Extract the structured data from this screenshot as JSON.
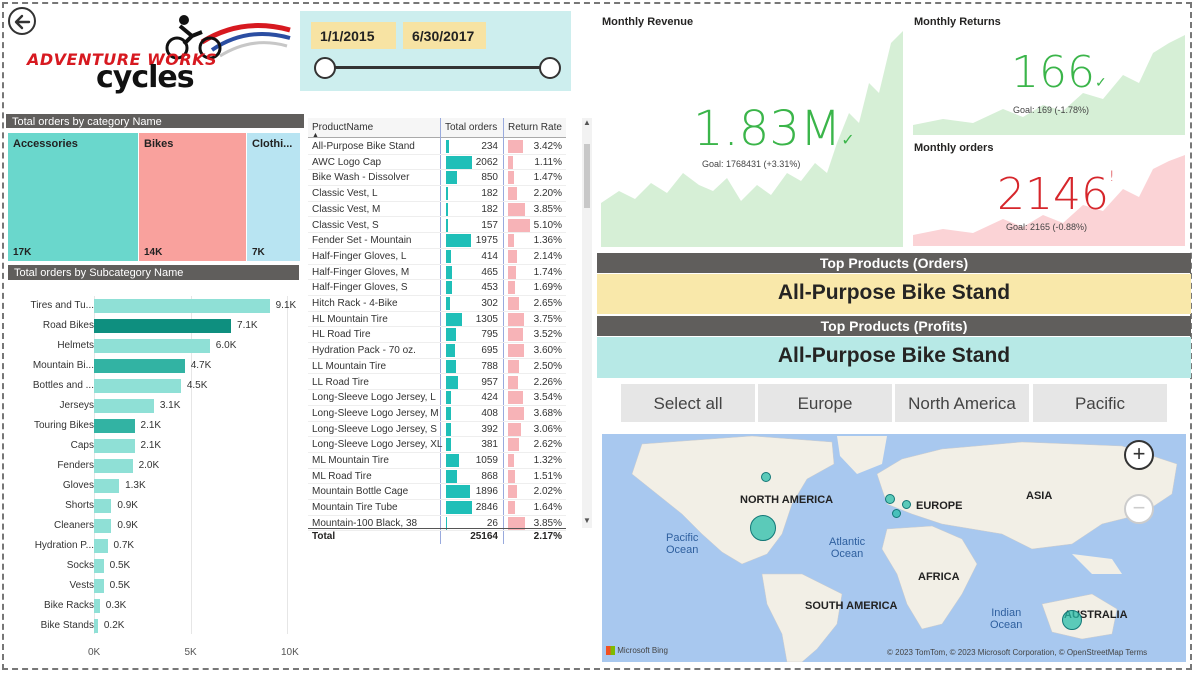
{
  "header": {
    "logo_line1": "ADVENTURE WORKS",
    "logo_line2": "cycles",
    "date_start": "1/1/2015",
    "date_end": "6/30/2017"
  },
  "treemap": {
    "title": "Total orders by category Name",
    "tiles": [
      {
        "label": "Accessories",
        "value": "17K",
        "color": "#6ad7cc"
      },
      {
        "label": "Bikes",
        "value": "14K",
        "color": "#f9a19d"
      },
      {
        "label": "Clothi...",
        "value": "7K",
        "color": "#b8e4f2"
      }
    ]
  },
  "subcategory_chart": {
    "title": "Total orders by Subcategory Name",
    "chart_data": {
      "type": "bar",
      "orientation": "horizontal",
      "categories": [
        "Tires and Tu...",
        "Road Bikes",
        "Helmets",
        "Mountain Bi...",
        "Bottles and ...",
        "Jerseys",
        "Touring Bikes",
        "Caps",
        "Fenders",
        "Gloves",
        "Shorts",
        "Cleaners",
        "Hydration P...",
        "Socks",
        "Vests",
        "Bike Racks",
        "Bike Stands"
      ],
      "values": [
        9100,
        7100,
        6000,
        4700,
        4500,
        3100,
        2100,
        2100,
        2000,
        1300,
        900,
        900,
        700,
        500,
        500,
        300,
        200
      ],
      "value_labels": [
        "9.1K",
        "7.1K",
        "6.0K",
        "4.7K",
        "4.5K",
        "3.1K",
        "2.1K",
        "2.1K",
        "2.0K",
        "1.3K",
        "0.9K",
        "0.9K",
        "0.7K",
        "0.5K",
        "0.5K",
        "0.3K",
        "0.2K"
      ],
      "highlighted": [
        "Road Bikes",
        "Mountain Bi...",
        "Touring Bikes"
      ],
      "x_ticks": [
        "0K",
        "5K",
        "10K"
      ],
      "xlim": [
        0,
        10000
      ],
      "grid": true
    }
  },
  "product_table": {
    "headers": [
      "ProductName",
      "Total orders",
      "Return Rate"
    ],
    "max_orders": 2062,
    "max_rate": 5.1,
    "rows": [
      {
        "name": "All-Purpose Bike Stand",
        "orders": "234",
        "orders_n": 234,
        "rate": "3.42%",
        "rate_n": 3.42
      },
      {
        "name": "AWC Logo Cap",
        "orders": "2062",
        "orders_n": 2062,
        "rate": "1.11%",
        "rate_n": 1.11
      },
      {
        "name": "Bike Wash - Dissolver",
        "orders": "850",
        "orders_n": 850,
        "rate": "1.47%",
        "rate_n": 1.47
      },
      {
        "name": "Classic Vest, L",
        "orders": "182",
        "orders_n": 182,
        "rate": "2.20%",
        "rate_n": 2.2
      },
      {
        "name": "Classic Vest, M",
        "orders": "182",
        "orders_n": 182,
        "rate": "3.85%",
        "rate_n": 3.85
      },
      {
        "name": "Classic Vest, S",
        "orders": "157",
        "orders_n": 157,
        "rate": "5.10%",
        "rate_n": 5.1
      },
      {
        "name": "Fender Set - Mountain",
        "orders": "1975",
        "orders_n": 1975,
        "rate": "1.36%",
        "rate_n": 1.36
      },
      {
        "name": "Half-Finger Gloves, L",
        "orders": "414",
        "orders_n": 414,
        "rate": "2.14%",
        "rate_n": 2.14
      },
      {
        "name": "Half-Finger Gloves, M",
        "orders": "465",
        "orders_n": 465,
        "rate": "1.74%",
        "rate_n": 1.74
      },
      {
        "name": "Half-Finger Gloves, S",
        "orders": "453",
        "orders_n": 453,
        "rate": "1.69%",
        "rate_n": 1.69
      },
      {
        "name": "Hitch Rack - 4-Bike",
        "orders": "302",
        "orders_n": 302,
        "rate": "2.65%",
        "rate_n": 2.65
      },
      {
        "name": "HL Mountain Tire",
        "orders": "1305",
        "orders_n": 1305,
        "rate": "3.75%",
        "rate_n": 3.75
      },
      {
        "name": "HL Road Tire",
        "orders": "795",
        "orders_n": 795,
        "rate": "3.52%",
        "rate_n": 3.52
      },
      {
        "name": "Hydration Pack - 70 oz.",
        "orders": "695",
        "orders_n": 695,
        "rate": "3.60%",
        "rate_n": 3.6
      },
      {
        "name": "LL Mountain Tire",
        "orders": "788",
        "orders_n": 788,
        "rate": "2.50%",
        "rate_n": 2.5
      },
      {
        "name": "LL Road Tire",
        "orders": "957",
        "orders_n": 957,
        "rate": "2.26%",
        "rate_n": 2.26
      },
      {
        "name": "Long-Sleeve Logo Jersey, L",
        "orders": "424",
        "orders_n": 424,
        "rate": "3.54%",
        "rate_n": 3.54
      },
      {
        "name": "Long-Sleeve Logo Jersey, M",
        "orders": "408",
        "orders_n": 408,
        "rate": "3.68%",
        "rate_n": 3.68
      },
      {
        "name": "Long-Sleeve Logo Jersey, S",
        "orders": "392",
        "orders_n": 392,
        "rate": "3.06%",
        "rate_n": 3.06
      },
      {
        "name": "Long-Sleeve Logo Jersey, XL",
        "orders": "381",
        "orders_n": 381,
        "rate": "2.62%",
        "rate_n": 2.62
      },
      {
        "name": "ML Mountain Tire",
        "orders": "1059",
        "orders_n": 1059,
        "rate": "1.32%",
        "rate_n": 1.32
      },
      {
        "name": "ML Road Tire",
        "orders": "868",
        "orders_n": 868,
        "rate": "1.51%",
        "rate_n": 1.51
      },
      {
        "name": "Mountain Bottle Cage",
        "orders": "1896",
        "orders_n": 1896,
        "rate": "2.02%",
        "rate_n": 2.02
      },
      {
        "name": "Mountain Tire Tube",
        "orders": "2846",
        "orders_n": 2846,
        "rate": "1.64%",
        "rate_n": 1.64
      },
      {
        "name": "Mountain-100 Black, 38",
        "orders": "26",
        "orders_n": 26,
        "rate": "3.85%",
        "rate_n": 3.85
      }
    ],
    "total_label": "Total",
    "total_orders": "25164",
    "total_rate": "2.17%"
  },
  "kpis": {
    "revenue": {
      "title": "Monthly Revenue",
      "value": "1.83M",
      "mark": "✓",
      "goal": "Goal: 1768431 (+3.31%)",
      "color": "#3bb54a",
      "area_color": "#d6efd6"
    },
    "returns": {
      "title": "Monthly Returns",
      "value": "166",
      "mark": "✓",
      "goal": "Goal: 169 (-1.78%)",
      "color": "#3bb54a",
      "area_color": "#d6efd6"
    },
    "orders": {
      "title": "Monthly orders",
      "value": "2146",
      "mark": "!",
      "goal": "Goal: 2165 (-0.88%)",
      "color": "#d6262b",
      "area_color": "#fbd3d6"
    }
  },
  "top_products": {
    "orders_title": "Top Products (Orders)",
    "orders_value": "All-Purpose Bike Stand",
    "profits_title": "Top Products (Profits)",
    "profits_value": "All-Purpose Bike Stand"
  },
  "region_slicer": [
    "Select all",
    "Europe",
    "North America",
    "Pacific"
  ],
  "map": {
    "labels": {
      "north_america": "NORTH AMERICA",
      "europe": "EUROPE",
      "asia": "ASIA",
      "africa": "AFRICA",
      "south_america": "SOUTH AMERICA",
      "australia": "AUSTRALIA"
    },
    "oceans": {
      "pacific_1": "Pacific",
      "pacific_2": "Ocean",
      "atlantic_1": "Atlantic",
      "atlantic_2": "Ocean",
      "indian_1": "Indian",
      "indian_2": "Ocean"
    },
    "zoom_in": "+",
    "zoom_out": "−",
    "provider": "Microsoft Bing",
    "credit": "© 2023 TomTom, © 2023 Microsoft Corporation, © OpenStreetMap  Terms"
  }
}
